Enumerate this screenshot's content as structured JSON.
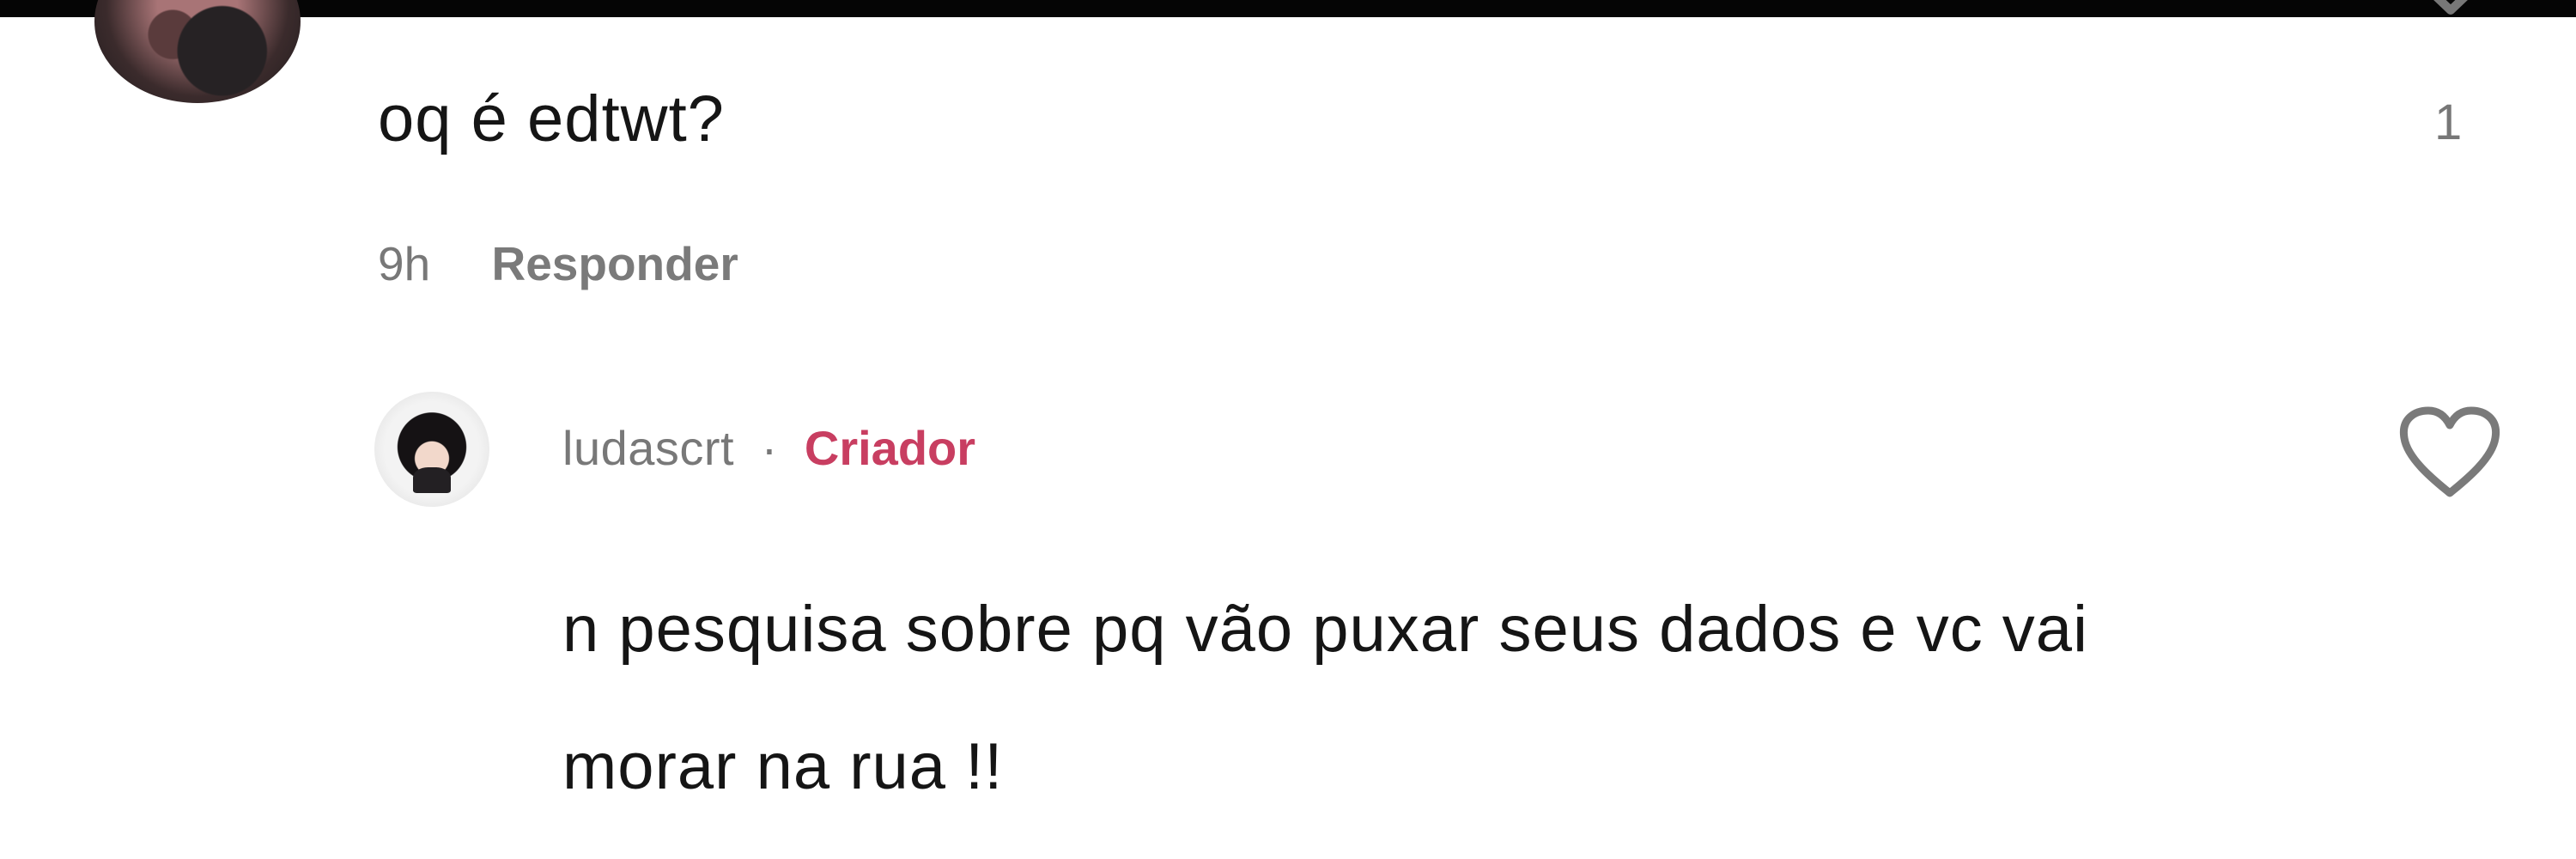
{
  "comment": {
    "text": "oq é edtwt?",
    "time": "9h",
    "reply_label": "Responder",
    "like_count": "1"
  },
  "reply": {
    "username": "ludascrt",
    "separator": "·",
    "badge": "Criador",
    "text": "n pesquisa sobre pq vão puxar seus dados e vc vai morar na rua !!"
  },
  "colors": {
    "text": "#151515",
    "muted": "#787878",
    "creator": "#c83e61",
    "icon": "#777777"
  },
  "icons": {
    "comment_like": "heart-outline-icon",
    "reply_like": "heart-outline-icon"
  }
}
